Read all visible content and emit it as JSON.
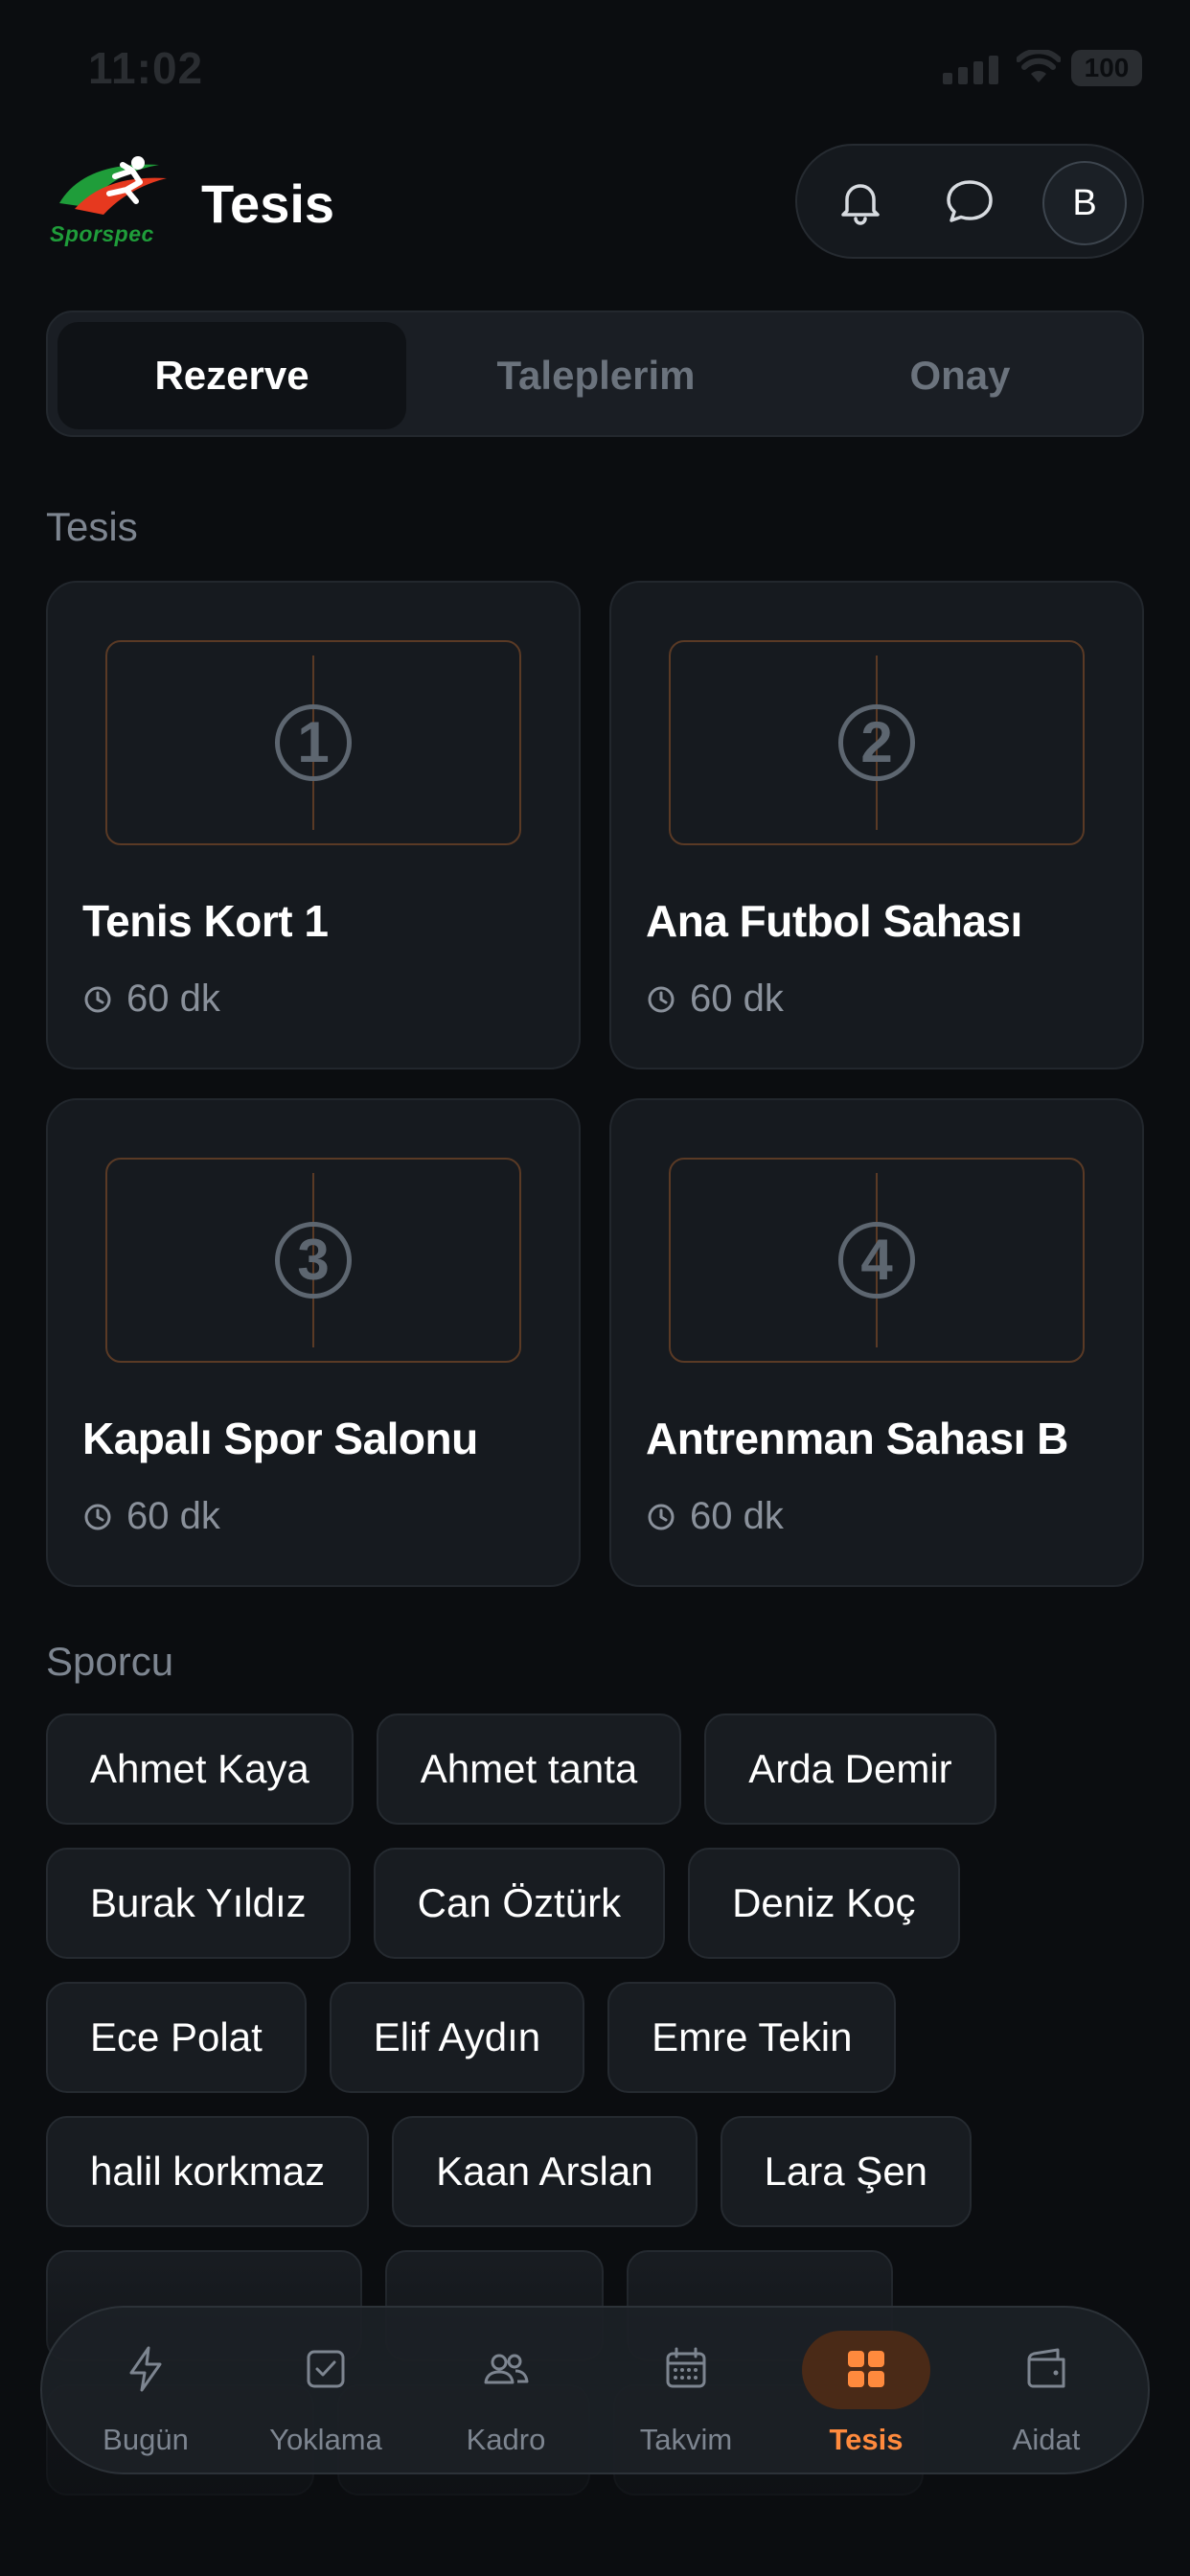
{
  "status_bar": {
    "time": "11:02",
    "battery": "100"
  },
  "header": {
    "title": "Tesis",
    "logo_text": "Sporspec",
    "avatar_initial": "B"
  },
  "tabs": [
    {
      "label": "Rezerve",
      "active": true
    },
    {
      "label": "Taleplerim",
      "active": false
    },
    {
      "label": "Onay",
      "active": false
    }
  ],
  "facility_section": {
    "title": "Tesis",
    "items": [
      {
        "number": "1",
        "name": "Tenis Kort 1",
        "duration": "60 dk"
      },
      {
        "number": "2",
        "name": "Ana Futbol Sahası",
        "duration": "60 dk"
      },
      {
        "number": "3",
        "name": "Kapalı Spor Salonu",
        "duration": "60 dk"
      },
      {
        "number": "4",
        "name": "Antrenman Sahası B",
        "duration": "60 dk"
      }
    ]
  },
  "athlete_section": {
    "title": "Sporcu",
    "athletes": [
      "Ahmet Kaya",
      "Ahmet tanta",
      "Arda Demir",
      "Burak Yıldız",
      "Can Öztürk",
      "Deniz Koç",
      "Ece Polat",
      "Elif Aydın",
      "Emre Tekin",
      "halil korkmaz",
      "Kaan Arslan",
      "Lara Şen"
    ]
  },
  "bottom_nav": [
    {
      "label": "Bugün",
      "icon": "bolt-icon",
      "active": false
    },
    {
      "label": "Yoklama",
      "icon": "checkbox-icon",
      "active": false
    },
    {
      "label": "Kadro",
      "icon": "users-icon",
      "active": false
    },
    {
      "label": "Takvim",
      "icon": "calendar-icon",
      "active": false
    },
    {
      "label": "Tesis",
      "icon": "grid-icon",
      "active": true
    },
    {
      "label": "Aidat",
      "icon": "wallet-icon",
      "active": false
    }
  ],
  "colors": {
    "accent": "#ff8a3d",
    "background": "#0b0d10",
    "card": "#161a1f"
  }
}
